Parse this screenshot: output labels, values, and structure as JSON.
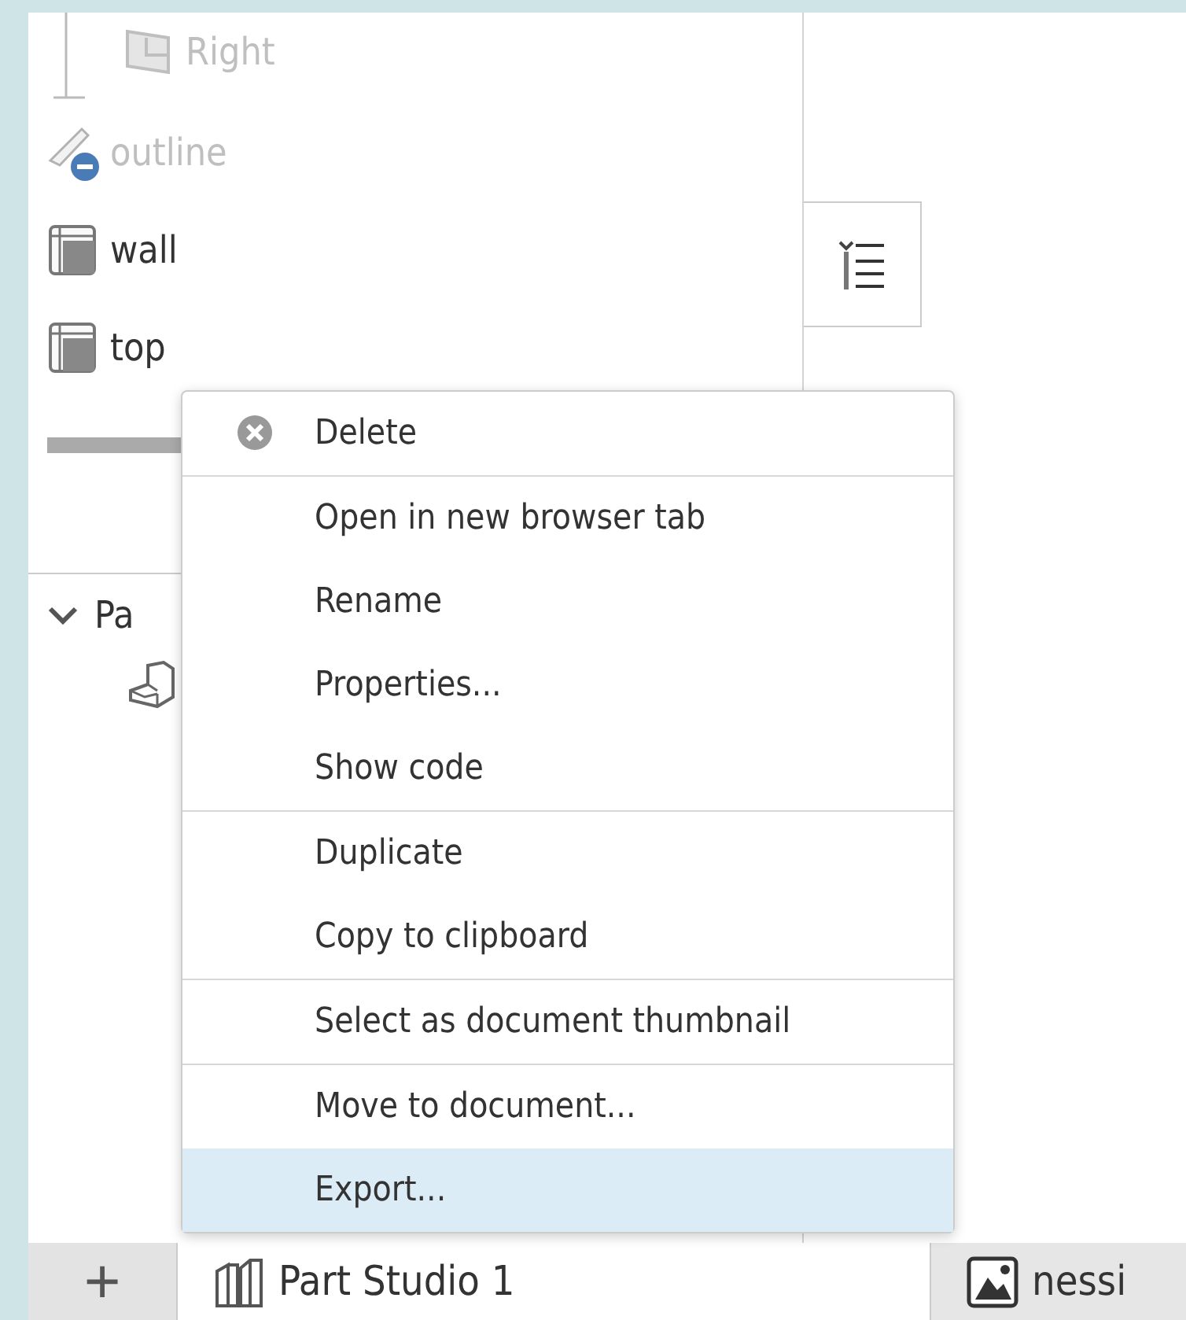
{
  "tree": {
    "items": [
      {
        "kind": "group",
        "children": [
          {
            "label": "Right",
            "kind": "plane",
            "dimmed": true
          }
        ]
      },
      {
        "label": "outline",
        "kind": "sketch",
        "dimmed": true
      },
      {
        "label": "wall",
        "kind": "part",
        "dimmed": false
      },
      {
        "label": "top",
        "kind": "part",
        "dimmed": false
      }
    ]
  },
  "parts_section": {
    "label": "Pa",
    "expanded": true
  },
  "context_menu": [
    {
      "label": "Delete",
      "kind": "delete",
      "separator_after": true,
      "selected": false
    },
    {
      "label": "Open in new browser tab",
      "separator_after": false,
      "selected": false
    },
    {
      "label": "Rename",
      "separator_after": false,
      "selected": false
    },
    {
      "label": "Properties...",
      "separator_after": false,
      "selected": false
    },
    {
      "label": "Show code",
      "separator_after": true,
      "selected": false
    },
    {
      "label": "Duplicate",
      "separator_after": false,
      "selected": false
    },
    {
      "label": "Copy to clipboard",
      "separator_after": true,
      "selected": false
    },
    {
      "label": "Select as document thumbnail",
      "separator_after": true,
      "selected": false
    },
    {
      "label": "Move to document...",
      "separator_after": false,
      "selected": false
    },
    {
      "label": "Export...",
      "separator_after": false,
      "selected": true
    }
  ],
  "tab_bar": {
    "add_button": "+",
    "tabs": [
      {
        "label": "Part Studio 1",
        "kind": "partstudio",
        "selected": true
      },
      {
        "label": "nessi",
        "kind": "image",
        "selected": false
      }
    ]
  }
}
